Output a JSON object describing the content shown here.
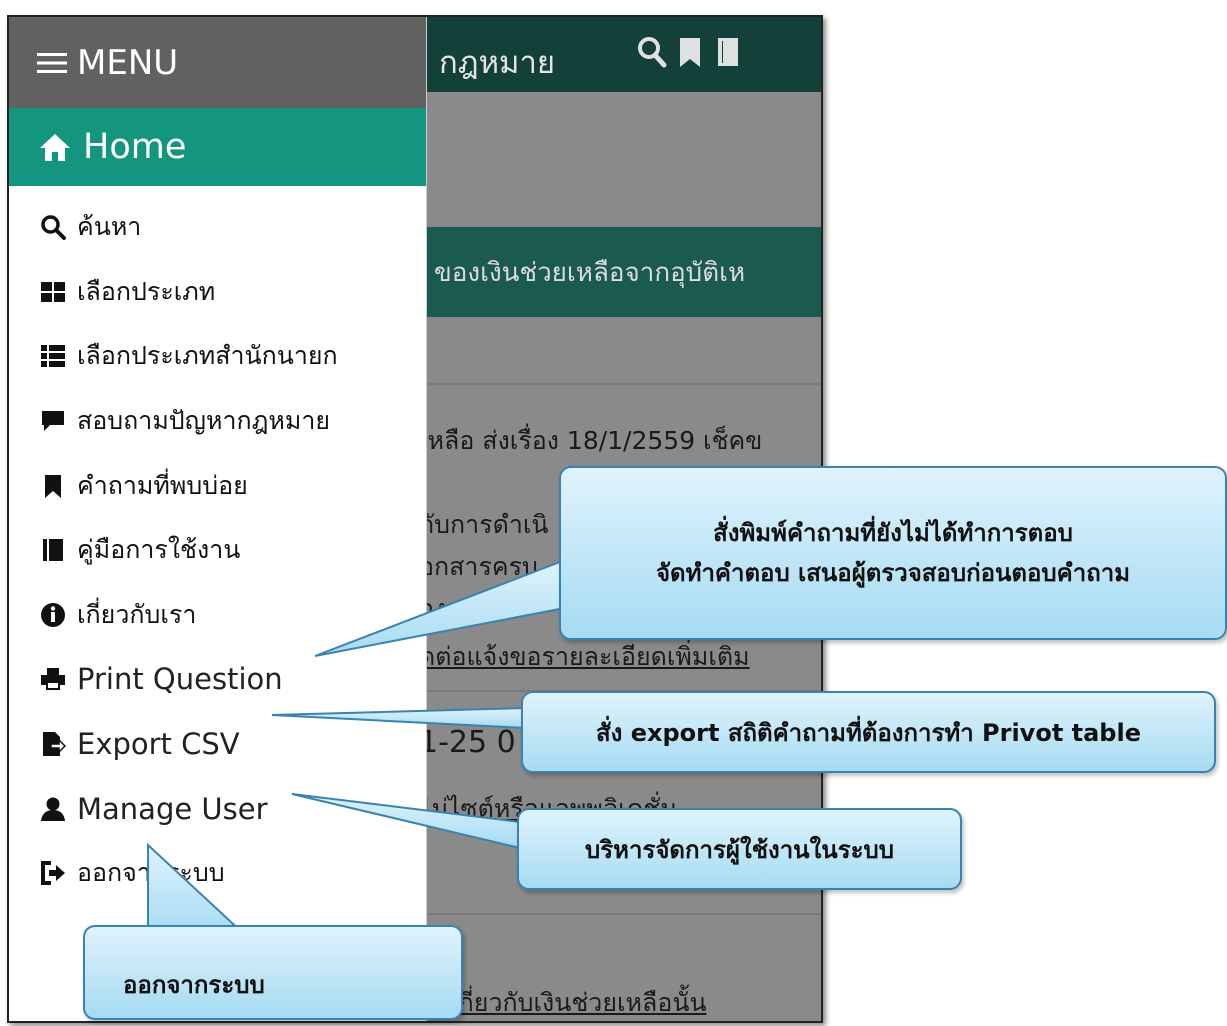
{
  "app": {
    "header_title": "กฎหมาย",
    "band_text": "ของเงินช่วยเหลือจากอุบัติเห",
    "bg_lines": [
      "เหลือ ส่งเรื่อง 18/1/2559 เช็คข",
      "กับการดำเนิ",
      "อกสารครบ",
      "อง",
      "ดต่อแจ้งขอรายละเอียดเพิ่มเติม",
      "1-25 0",
      "ไม่ไซต์หรือแอพพลิเคชั่น",
      "น้าเกี่ยวกับเงินช่วยเหลือนั้น"
    ]
  },
  "menu": {
    "title": "MENU",
    "home": "Home",
    "items": [
      {
        "label": "ค้นหา",
        "icon": "search-icon"
      },
      {
        "label": "เลือกประเภท",
        "icon": "grid-icon"
      },
      {
        "label": "เลือกประเภทสำนักนายก",
        "icon": "list-icon"
      },
      {
        "label": "สอบถามปัญหากฎหมาย",
        "icon": "comment-icon"
      },
      {
        "label": "คำถามที่พบบ่อย",
        "icon": "bookmark-icon"
      },
      {
        "label": "คู่มือการใช้งาน",
        "icon": "book-icon"
      },
      {
        "label": "เกี่ยวกับเรา",
        "icon": "info-icon"
      },
      {
        "label": "Print Question",
        "icon": "print-icon"
      },
      {
        "label": "Export CSV",
        "icon": "export-icon"
      },
      {
        "label": "Manage User",
        "icon": "user-icon"
      },
      {
        "label": "ออกจากระบบ",
        "icon": "logout-icon"
      }
    ]
  },
  "callouts": {
    "print_line1": "สั่งพิมพ์คำถามที่ยังไม่ได้ทำการตอบ",
    "print_line2": "จัดทำคำตอบ เสนอผู้ตรวจสอบก่อนตอบคำถาม",
    "export": "สั่ง export สถิติคำถามที่ต้องการทำ Privot table",
    "manage": "บริหารจัดการผู้ใช้งานในระบบ",
    "logout": "ออกจากระบบ"
  },
  "colors": {
    "menu_header_bg": "#616161",
    "home_bg": "#13967d",
    "app_header_bg": "#14403a",
    "callout_border": "#3a82b0"
  }
}
